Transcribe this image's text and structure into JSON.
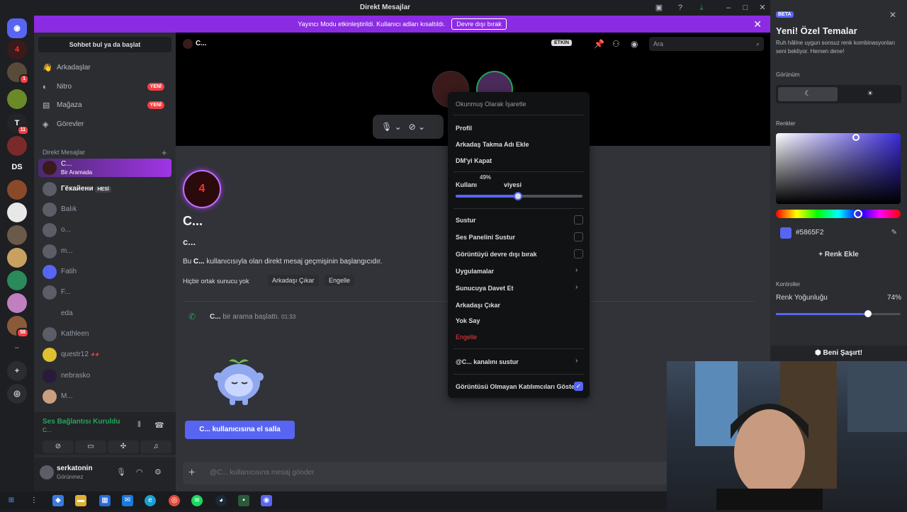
{
  "window": {
    "title": "Direkt Mesajlar"
  },
  "banner": {
    "text": "Yayıncı Modu etkinleştirildi. Kullanıcı adları kısaltıldı.",
    "button": "Devre dışı bırak"
  },
  "servers": [
    {
      "label": "DS"
    },
    {
      "label": "T"
    }
  ],
  "server_badges": [
    "1",
    "11",
    "58"
  ],
  "dm_column": {
    "search": "Sohbet bul ya da başlat",
    "nav": [
      {
        "label": "Arkadaşlar"
      },
      {
        "label": "Nitro",
        "badge": "YENİ"
      },
      {
        "label": "Mağaza",
        "badge": "YENİ"
      },
      {
        "label": "Görevler"
      }
    ],
    "dm_header": "Direkt Mesajlar",
    "dms": [
      {
        "name": "C...",
        "sub": "Bir Aramada"
      },
      {
        "name": "Гёкайени",
        "tag": "HESİ"
      },
      {
        "name": "Balık"
      },
      {
        "name": "o..."
      },
      {
        "name": "m..."
      },
      {
        "name": "Fatih"
      },
      {
        "name": "F..."
      },
      {
        "name": "eda"
      },
      {
        "name": "Kathleen"
      },
      {
        "name": "questr12"
      },
      {
        "name": "nebrasko"
      },
      {
        "name": "M..."
      }
    ],
    "voice": {
      "status": "Ses Bağlantısı Kuruldu",
      "channel": "C..."
    },
    "user": {
      "name": "serkatonin",
      "status": "Görünmez"
    }
  },
  "main": {
    "header_name": "C...",
    "active_badge": "ETKİN",
    "search_placeholder": "Ara",
    "big_name": "C...",
    "username": "c...",
    "intro_pre": "Bu ",
    "intro_name": "C...",
    "intro_post": " kullanıcısıyla olan direkt mesaj geçmişinin başlangıcıdır.",
    "no_mutual": "Hiçbir ortak sunucu yok",
    "remove_friend": "Arkadaşı Çıkar",
    "block": "Engelle",
    "call_name": "C...",
    "call_text": " bir arama başlattı.",
    "call_time": "01:33",
    "wave_button": "C... kullanıcısına el salla",
    "message_placeholder": "@C... kullanıcısına mesaj gönder"
  },
  "context_menu": {
    "mark_read": "Okunmuş Olarak İşaretle",
    "profile": "Profil",
    "nickname": "Arkadaş Takma Adı Ekle",
    "close_dm": "DM'yi Kapat",
    "volume_label_a": "Kullanı",
    "volume_label_b": "viyesi",
    "volume_tooltip": "49%",
    "volume_value": 0.49,
    "mute": "Sustur",
    "mute_soundboard": "Ses Panelini Sustur",
    "disable_video": "Görüntüyü devre dışı bırak",
    "apps": "Uygulamalar",
    "invite": "Sunucuya Davet Et",
    "remove_friend": "Arkadaşı Çıkar",
    "ignore": "Yok Say",
    "block": "Engelle",
    "mute_channel": "@C... kanalını sustur",
    "show_non_video": "Görüntüsü Olmayan Katılımcıları Göster"
  },
  "theme_panel": {
    "beta": "BETA",
    "title": "Yeni! Özel Temalar",
    "desc": "Ruh hâline uygun sonsuz renk kombinasyonları seni bekliyor. Hemen dene!",
    "appearance": "Görünüm",
    "colors": "Renkler",
    "hex": "#5865F2",
    "swatch_color": "#5865F2",
    "add_color": "Renk Ekle",
    "controls": "Kontroller",
    "intensity_label": "Renk Yoğunluğu",
    "intensity_pct": "74%",
    "intensity_value": 0.74,
    "surprise": "Beni Şaşırt!"
  }
}
